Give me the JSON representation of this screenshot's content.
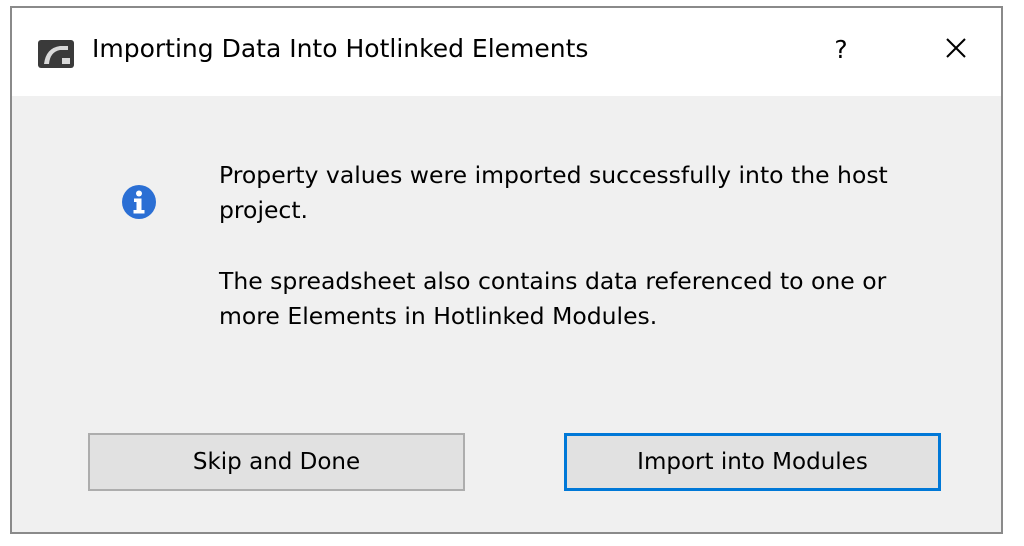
{
  "dialog": {
    "title": "Importing Data Into Hotlinked Elements",
    "help_label": "?",
    "icons": {
      "app": "archicad-app-icon",
      "close": "close-icon",
      "info": "info-icon"
    },
    "message": {
      "line1": "Property values were imported successfully into the host project.",
      "line2": "The spreadsheet also contains data referenced to one or more Elements in Hotlinked Modules."
    },
    "buttons": {
      "skip_label": "Skip and Done",
      "import_label": "Import into Modules"
    },
    "colors": {
      "accent": "#0078d7",
      "info_icon": "#2b6fd4",
      "button_bg": "#e1e1e1",
      "body_bg": "#f0f0f0"
    }
  }
}
